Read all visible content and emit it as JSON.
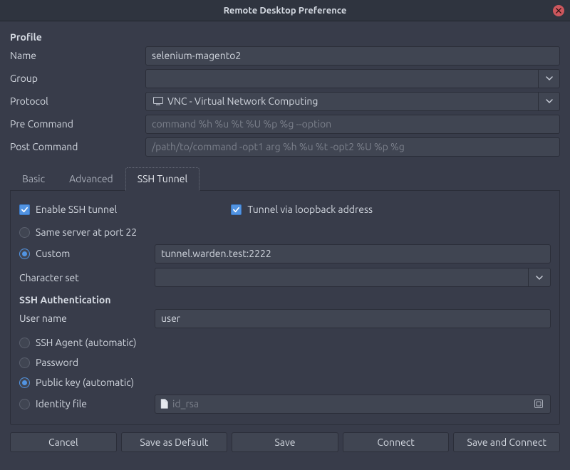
{
  "window": {
    "title": "Remote Desktop Preference"
  },
  "profile": {
    "heading": "Profile",
    "name_label": "Name",
    "name_value": "selenium-magento2",
    "group_label": "Group",
    "group_value": "",
    "protocol_label": "Protocol",
    "protocol_value": "VNC - Virtual Network Computing",
    "pre_cmd_label": "Pre Command",
    "pre_cmd_placeholder": "command %h %u %t %U %p %g --option",
    "post_cmd_label": "Post Command",
    "post_cmd_placeholder": "/path/to/command -opt1 arg %h %u %t -opt2 %U %p %g"
  },
  "tabs": {
    "basic": "Basic",
    "advanced": "Advanced",
    "ssh_tunnel": "SSH Tunnel",
    "active": "ssh_tunnel"
  },
  "ssh": {
    "enable_label": "Enable SSH tunnel",
    "enable_checked": true,
    "loopback_label": "Tunnel via loopback address",
    "loopback_checked": true,
    "same_server_label": "Same server at port 22",
    "same_server_selected": false,
    "custom_label": "Custom",
    "custom_selected": true,
    "custom_value": "tunnel.warden.test:2222",
    "charset_label": "Character set",
    "charset_value": "",
    "auth_heading": "SSH Authentication",
    "username_label": "User name",
    "username_value": "user",
    "ssh_agent_label": "SSH Agent (automatic)",
    "ssh_agent_selected": false,
    "password_label": "Password",
    "password_selected": false,
    "public_key_label": "Public key (automatic)",
    "public_key_selected": true,
    "identity_file_label": "Identity file",
    "identity_file_selected": false,
    "identity_placeholder": "id_rsa"
  },
  "buttons": {
    "cancel": "Cancel",
    "save_default": "Save as Default",
    "save": "Save",
    "connect": "Connect",
    "save_connect": "Save and Connect"
  }
}
